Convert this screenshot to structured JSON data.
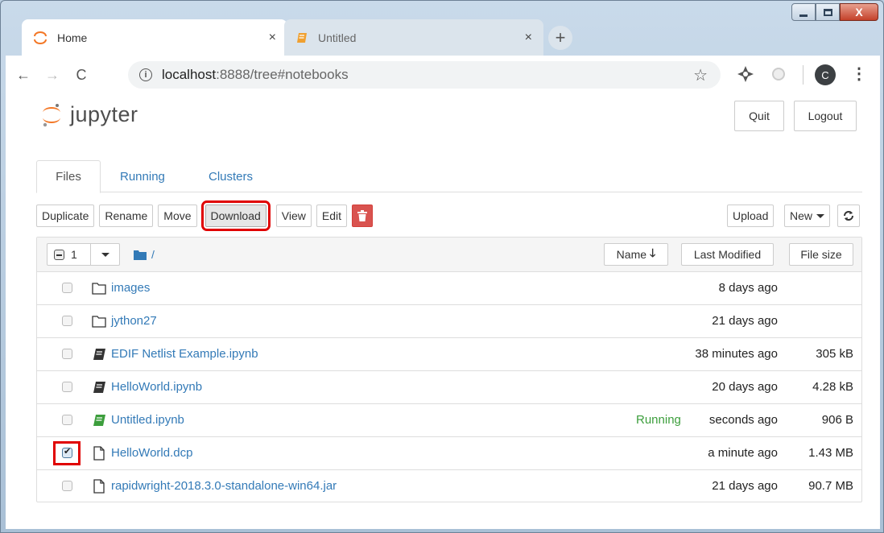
{
  "window": {
    "close_glyph": "X"
  },
  "browser": {
    "tabs": [
      {
        "title": "Home",
        "close": "×"
      },
      {
        "title": "Untitled",
        "close": "×"
      }
    ],
    "new_tab": "+",
    "nav": {
      "back": "←",
      "forward": "→",
      "reload": "C"
    },
    "url_host": "localhost",
    "url_path": ":8888/tree#notebooks",
    "info_glyph": "i",
    "star_glyph": "☆",
    "avatar_letter": "C",
    "menu_glyph": "⋮"
  },
  "header": {
    "logo_text": "jupyter",
    "quit_label": "Quit",
    "logout_label": "Logout"
  },
  "nav_tabs": {
    "files": "Files",
    "running": "Running",
    "clusters": "Clusters"
  },
  "toolbar": {
    "duplicate": "Duplicate",
    "rename": "Rename",
    "move": "Move",
    "download": "Download",
    "view": "View",
    "edit": "Edit",
    "upload": "Upload",
    "new": "New"
  },
  "list_header": {
    "selected_count": "1",
    "path": "/",
    "name_col": "Name",
    "name_sort_glyph": "🡓",
    "modified_col": "Last Modified",
    "size_col": "File size"
  },
  "files": [
    {
      "name": "images",
      "type": "folder",
      "status": "",
      "modified": "8 days ago",
      "size": ""
    },
    {
      "name": "jython27",
      "type": "folder",
      "status": "",
      "modified": "21 days ago",
      "size": ""
    },
    {
      "name": "EDIF Netlist Example.ipynb",
      "type": "notebook",
      "status": "",
      "modified": "38 minutes ago",
      "size": "305 kB"
    },
    {
      "name": "HelloWorld.ipynb",
      "type": "notebook",
      "status": "",
      "modified": "20 days ago",
      "size": "4.28 kB"
    },
    {
      "name": "Untitled.ipynb",
      "type": "notebook-running",
      "status": "Running",
      "modified": "seconds ago",
      "size": "906 B"
    },
    {
      "name": "HelloWorld.dcp",
      "type": "file",
      "status": "",
      "modified": "a minute ago",
      "size": "1.43 MB",
      "checked": true
    },
    {
      "name": "rapidwright-2018.3.0-standalone-win64.jar",
      "type": "file",
      "status": "",
      "modified": "21 days ago",
      "size": "90.7 MB"
    }
  ],
  "colors": {
    "link": "#337ab7",
    "running": "#3c9e3c",
    "highlight": "#e00000",
    "jupyter_orange": "#f37726"
  }
}
